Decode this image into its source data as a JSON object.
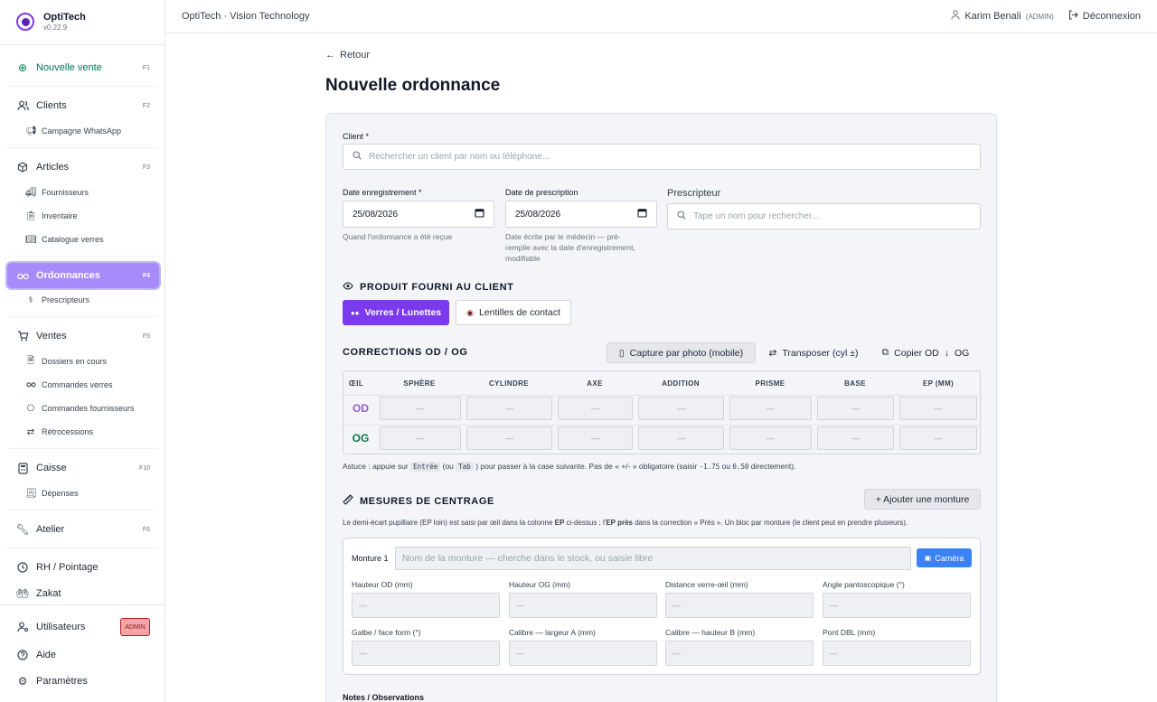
{
  "brand": {
    "name": "OptiTech",
    "version": "v0.22.9"
  },
  "sidebar": {
    "new_sale": {
      "label": "Nouvelle vente",
      "key": "F1"
    },
    "clients": {
      "label": "Clients",
      "key": "F2"
    },
    "whatsapp": "Campagne WhatsApp",
    "articles": {
      "label": "Articles",
      "key": "F3"
    },
    "fournisseurs": "Fournisseurs",
    "inventaire": "Inventaire",
    "catalogue": "Catalogue verres",
    "ordonnances": {
      "label": "Ordonnances",
      "key": "F4"
    },
    "prescripteurs": "Prescripteurs",
    "ventes": {
      "label": "Ventes",
      "key": "F5"
    },
    "dossiers": "Dossiers en cours",
    "commandes_verres": "Commandes verres",
    "commandes_fournisseurs": "Commandes fournisseurs",
    "retrocessions": "Rétrocessions",
    "caisse": {
      "label": "Caisse",
      "key": "F10"
    },
    "depenses": "Dépenses",
    "atelier": {
      "label": "Atelier",
      "key": "F6"
    },
    "rh": "RH / Pointage",
    "zakat": "Zakat",
    "utilisateurs": "Utilisateurs",
    "utilisateurs_badge": "ADMIN",
    "aide": "Aide",
    "parametres": "Paramètres"
  },
  "topbar": {
    "title": "OptiTech · Vision Technology",
    "user": "Karim Benali",
    "role": "(ADMIN)",
    "logout": "Déconnexion"
  },
  "page": {
    "back": "Retour",
    "title": "Nouvelle ordonnance"
  },
  "form": {
    "client_label": "Client *",
    "client_placeholder": "Rechercher un client par nom ou téléphone...",
    "date_enr_label": "Date enregistrement *",
    "date_enr_value": "25/08/2026",
    "date_enr_hint": "Quand l'ordonnance a été reçue",
    "date_presc_label": "Date de prescription",
    "date_presc_value": "25/08/2026",
    "date_presc_hint1": "Date écrite par le médecin — pré-",
    "date_presc_hint2": "remplie avec la date d'enregistrement,",
    "date_presc_hint3": "modifiable",
    "prescripteur_label": "Prescripteur",
    "prescripteur_placeholder": "Tape un nom pour rechercher..."
  },
  "produit": {
    "title": "PRODUIT FOURNI AU CLIENT",
    "verres": "Verres / Lunettes",
    "lentilles": "Lentilles de contact"
  },
  "corrections": {
    "title": "CORRECTIONS OD / OG",
    "capture": "Capture par photo (mobile)",
    "transposer": "Transposer (cyl ±)",
    "copier": "Copier OD",
    "copier_target": "OG",
    "headers": [
      "ŒIL",
      "SPHÈRE",
      "CYLINDRE",
      "AXE",
      "ADDITION",
      "PRISME",
      "BASE",
      "EP (MM)"
    ],
    "od": "OD",
    "og": "OG",
    "empty": "—",
    "tip_a": "Astuce : appuie sur",
    "tip_key1": "Entrée",
    "tip_b": "(ou",
    "tip_key2": "Tab",
    "tip_c": ") pour passer à la case suivante. Pas de « +/- » obligatoire (saisir",
    "tip_v1": "-1.75",
    "tip_d": "ou",
    "tip_v2": "0.50",
    "tip_e": "directement)."
  },
  "mesures": {
    "title": "MESURES DE CENTRAGE",
    "add": "+ Ajouter une monture",
    "desc_a": "Le demi-écart pupillaire (EP loin) est saisi par œil dans la colonne",
    "desc_ep": "EP",
    "desc_b": "ci-dessus ; l'",
    "desc_epp": "EP près",
    "desc_c": "dans la correction « Près ». Un bloc par monture (le client peut en prendre plusieurs).",
    "monture_label": "Monture 1",
    "monture_placeholder": "Nom de la monture — cherche dans le stock, ou saisie libre",
    "camera": "Caméra",
    "fields": [
      "Hauteur OD (mm)",
      "Hauteur OG (mm)",
      "Distance verre-œil (mm)",
      "Angle pantoscopique (°)",
      "Galbe / face form (°)",
      "Calibre — largeur A (mm)",
      "Calibre — hauteur B (mm)",
      "Pont DBL (mm)"
    ],
    "empty": "—"
  },
  "notes": {
    "label": "Notes / Observations"
  },
  "colors": {
    "accent": "#7c3aed",
    "active_nav": "#a78bfa",
    "green": "#047857",
    "od": "#9b59d0",
    "og": "#0a7a4a"
  }
}
